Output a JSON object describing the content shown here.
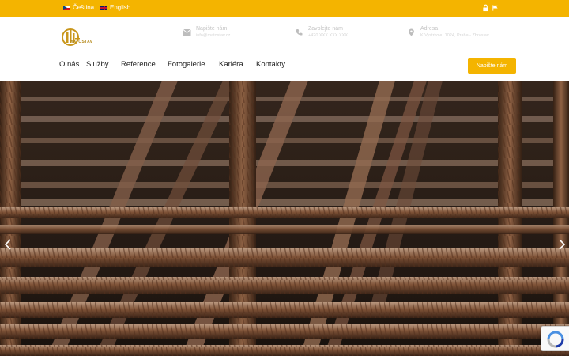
{
  "topbar": {
    "languages": [
      {
        "label": "Čeština",
        "flag": "cz-flag-icon"
      },
      {
        "label": "English",
        "flag": "uk-flag-icon"
      }
    ],
    "icons": [
      "lock-icon",
      "flag-icon"
    ],
    "background": "#f4b400"
  },
  "header": {
    "logo_text": "MATOSTAV",
    "contacts": [
      {
        "icon": "envelope-icon",
        "title": "Napište nám",
        "value": "info@matostav.cz"
      },
      {
        "icon": "phone-icon",
        "title": "Zavolejte nám",
        "value": "+420 XXX XXX XXX"
      },
      {
        "icon": "map-pin-icon",
        "title": "Adresa",
        "value": "K Vystrkovu 1024, Praha - Zbraslav"
      }
    ]
  },
  "nav": {
    "items": [
      {
        "label": "O nás"
      },
      {
        "label": "Služby"
      },
      {
        "label": "Reference"
      },
      {
        "label": "Fotogalerie"
      },
      {
        "label": "Kariéra"
      },
      {
        "label": "Kontakty"
      }
    ],
    "cta_label": "Napište nám"
  },
  "hero": {
    "image": "rusty rebar steel mesh",
    "prev_icon": "chevron-left-icon",
    "next_icon": "chevron-right-icon"
  },
  "colors": {
    "accent": "#f4b400",
    "text": "#222222"
  }
}
